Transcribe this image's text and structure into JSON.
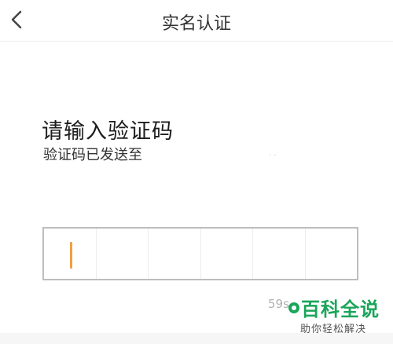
{
  "header": {
    "title": "实名认证",
    "back_icon": "chevron-left-icon"
  },
  "main": {
    "heading": "请输入验证码",
    "subtitle": "验证码已发送至",
    "sent_to_fragment": ". .",
    "code_cells": [
      "",
      "",
      "",
      "",
      "",
      ""
    ],
    "countdown": "59s"
  },
  "watermark": {
    "brand": "百科全说",
    "slogan": "助你轻松解决"
  },
  "colors": {
    "caret": "#f0a040",
    "brand": "#1aa55a",
    "box_border": "#bdbdbd"
  }
}
